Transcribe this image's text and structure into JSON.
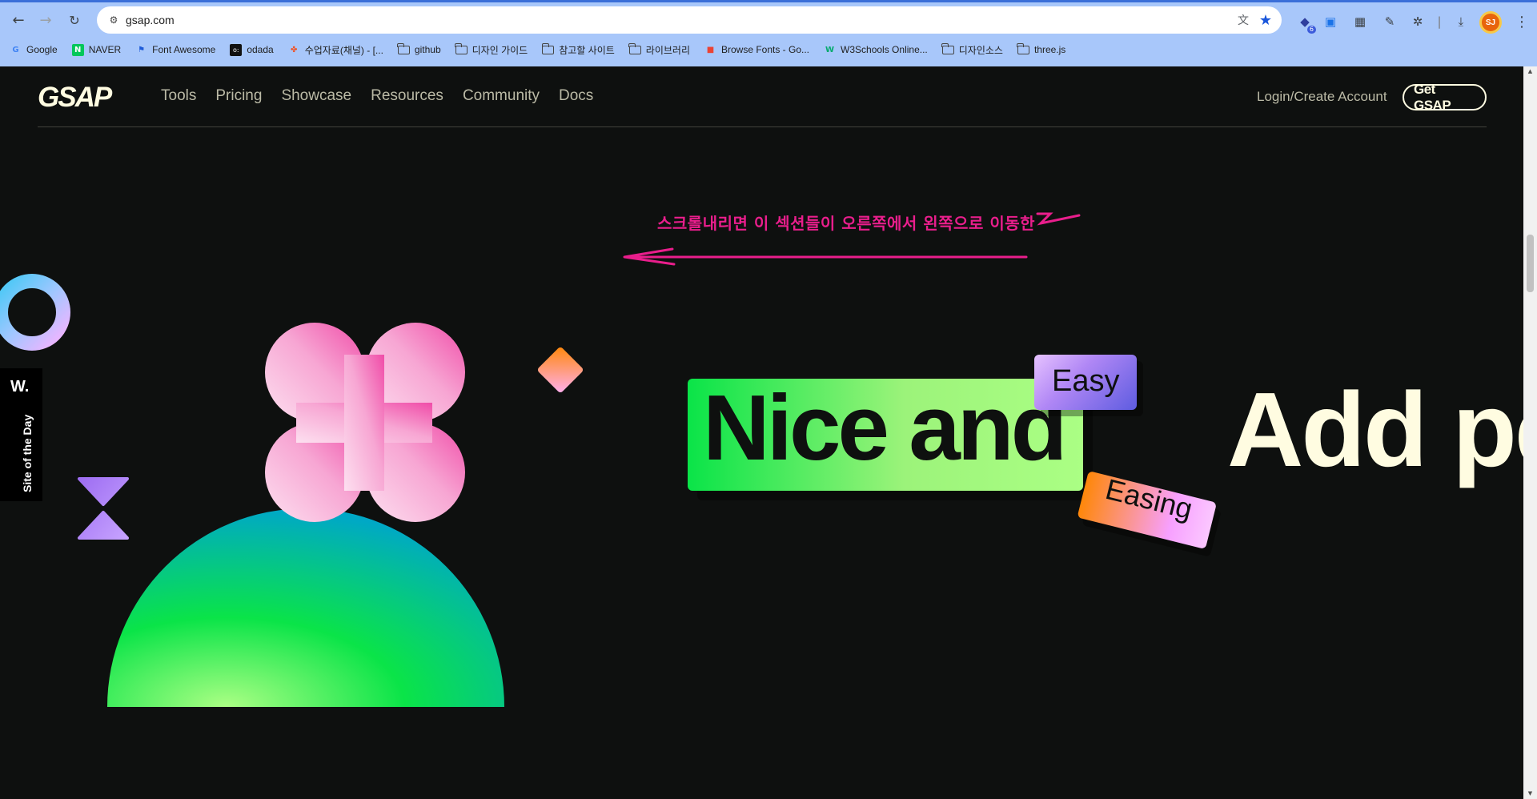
{
  "browser": {
    "url": "gsap.com",
    "extension_badge": "6",
    "avatar_initials": "SJ",
    "bookmarks": [
      {
        "label": "Google",
        "icon": "google-icon"
      },
      {
        "label": "NAVER",
        "icon": "naver-icon"
      },
      {
        "label": "Font Awesome",
        "icon": "flag-icon"
      },
      {
        "label": "odada",
        "icon": "odada-icon"
      },
      {
        "label": "수업자료(채널) - [...",
        "icon": "figma-icon"
      },
      {
        "label": "github",
        "icon": "folder-icon"
      },
      {
        "label": "디자인 가이드",
        "icon": "folder-icon"
      },
      {
        "label": "참고할 사이트",
        "icon": "folder-icon"
      },
      {
        "label": "라이브러리",
        "icon": "folder-icon"
      },
      {
        "label": "Browse Fonts - Go...",
        "icon": "google-fonts-icon"
      },
      {
        "label": "W3Schools Online...",
        "icon": "w3schools-icon"
      },
      {
        "label": "디자인소스",
        "icon": "folder-icon"
      },
      {
        "label": "three.js",
        "icon": "folder-icon"
      }
    ]
  },
  "site": {
    "logo": "GSAP",
    "nav": [
      "Tools",
      "Pricing",
      "Showcase",
      "Resources",
      "Community",
      "Docs"
    ],
    "login": "Login/Create Account",
    "cta": "Get GSAP",
    "annotation": "스크롤내리면 이 섹션들이 오른쪽에서 왼쪽으로 이동한",
    "sotd_letter": "W.",
    "sotd_label": "Site of the Day",
    "hero": {
      "nice": "Nice and",
      "easy": "Easy",
      "easing": "Easing",
      "add": "Add pe"
    }
  },
  "colors": {
    "page_bg": "#0e100f",
    "text_light": "#fffce1",
    "nav_text": "#bbbaa6",
    "green": "#0ae448",
    "annotation_pink": "#e91e8c"
  }
}
